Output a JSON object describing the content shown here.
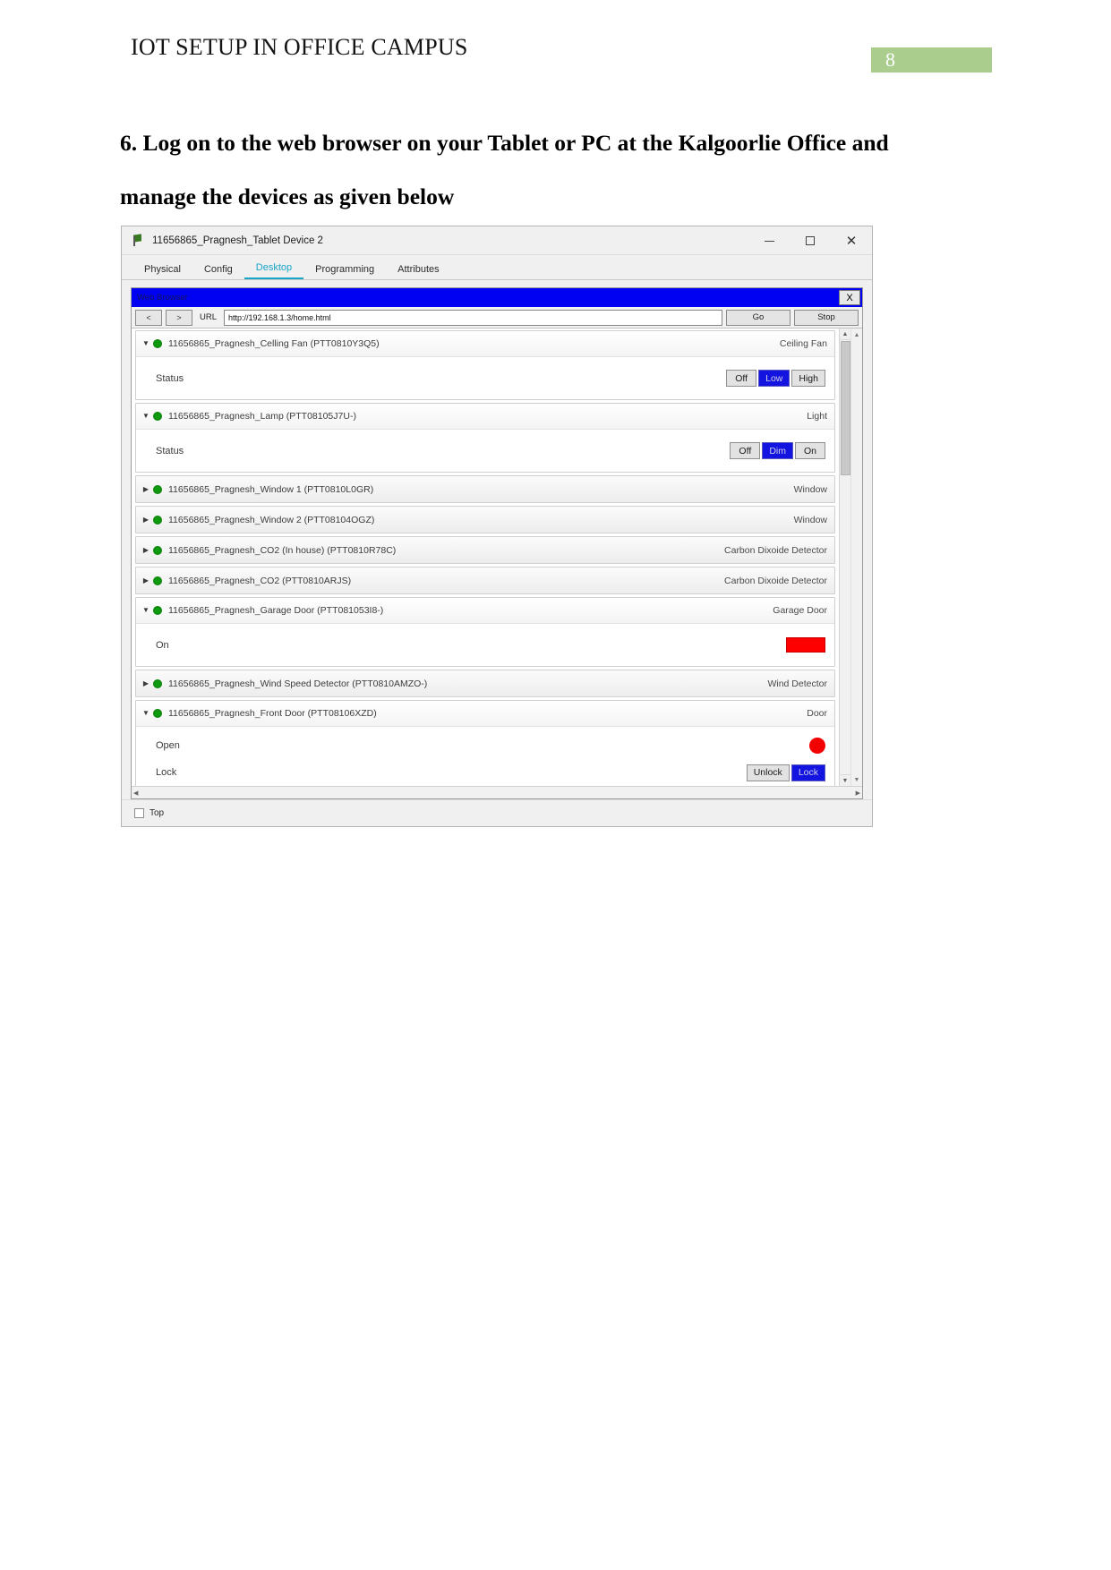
{
  "document": {
    "header_title": "IOT SETUP IN OFFICE CAMPUS",
    "page_number": "8",
    "page_badge_color": "#aacd8e",
    "heading": "6. Log on to the web browser on your Tablet or PC at the Kalgoorlie Office and manage the devices as given below"
  },
  "pt_window": {
    "title": "11656865_Pragnesh_Tablet Device 2",
    "icon": "packet-tracer-flag-icon",
    "minimize": "—",
    "maximize": "□",
    "close": "✕",
    "tabs": [
      {
        "label": "Physical",
        "active": false
      },
      {
        "label": "Config",
        "active": false
      },
      {
        "label": "Desktop",
        "active": true
      },
      {
        "label": "Programming",
        "active": false
      },
      {
        "label": "Attributes",
        "active": false
      }
    ],
    "active_tab_color": "#1aa5c8",
    "footer": {
      "checkbox_label": "Top",
      "checked": false
    }
  },
  "browser": {
    "title": "Web Browser",
    "titlebar_color": "#0000f2",
    "close_label": "X",
    "back_label": "<",
    "forward_label": ">",
    "url_label": "URL",
    "url_value": "http://192.168.1.3/home.html",
    "url_placeholder": "http://",
    "go_label": "Go",
    "stop_label": "Stop"
  },
  "devices": [
    {
      "name": "11656865_Pragnesh_Celling Fan (PTT0810Y3Q5)",
      "type": "Ceiling Fan",
      "expanded": true,
      "status_color": "#0f9a0f",
      "panel": {
        "label": "Status",
        "buttons": [
          {
            "label": "Off",
            "selected": false
          },
          {
            "label": "Low",
            "selected": true
          },
          {
            "label": "High",
            "selected": false
          }
        ]
      }
    },
    {
      "name": "11656865_Pragnesh_Lamp (PTT08105J7U-)",
      "type": "Light",
      "expanded": true,
      "status_color": "#0f9a0f",
      "panel": {
        "label": "Status",
        "buttons": [
          {
            "label": "Off",
            "selected": false
          },
          {
            "label": "Dim",
            "selected": true
          },
          {
            "label": "On",
            "selected": false
          }
        ]
      }
    },
    {
      "name": "11656865_Pragnesh_Window 1 (PTT0810L0GR)",
      "type": "Window",
      "expanded": false,
      "status_color": "#0f9a0f"
    },
    {
      "name": "11656865_Pragnesh_Window 2 (PTT08104OGZ)",
      "type": "Window",
      "expanded": false,
      "status_color": "#0f9a0f"
    },
    {
      "name": "11656865_Pragnesh_CO2 (In house) (PTT0810R78C)",
      "type": "Carbon Dixoide Detector",
      "expanded": false,
      "status_color": "#0f9a0f"
    },
    {
      "name": "11656865_Pragnesh_CO2 (PTT0810ARJS)",
      "type": "Carbon Dixoide Detector",
      "expanded": false,
      "status_color": "#0f9a0f"
    },
    {
      "name": "11656865_Pragnesh_Garage Door (PTT081053I8-)",
      "type": "Garage Door",
      "expanded": true,
      "status_color": "#0f9a0f",
      "panel": {
        "label": "On",
        "indicator": "red-rectangle",
        "indicator_color": "#ff0000"
      }
    },
    {
      "name": "11656865_Pragnesh_Wind Speed Detector (PTT0810AMZO-)",
      "type": "Wind Detector",
      "expanded": false,
      "status_color": "#0f9a0f"
    },
    {
      "name": "11656865_Pragnesh_Front Door (PTT08106XZD)",
      "type": "Door",
      "expanded": true,
      "status_color": "#0f9a0f",
      "panel": {
        "label": "Open",
        "indicator": "red-circle",
        "indicator_color": "#f40000",
        "label2": "Lock",
        "buttons": [
          {
            "label": "Unlock",
            "selected": false
          },
          {
            "label": "Lock",
            "selected": true
          }
        ]
      }
    }
  ]
}
